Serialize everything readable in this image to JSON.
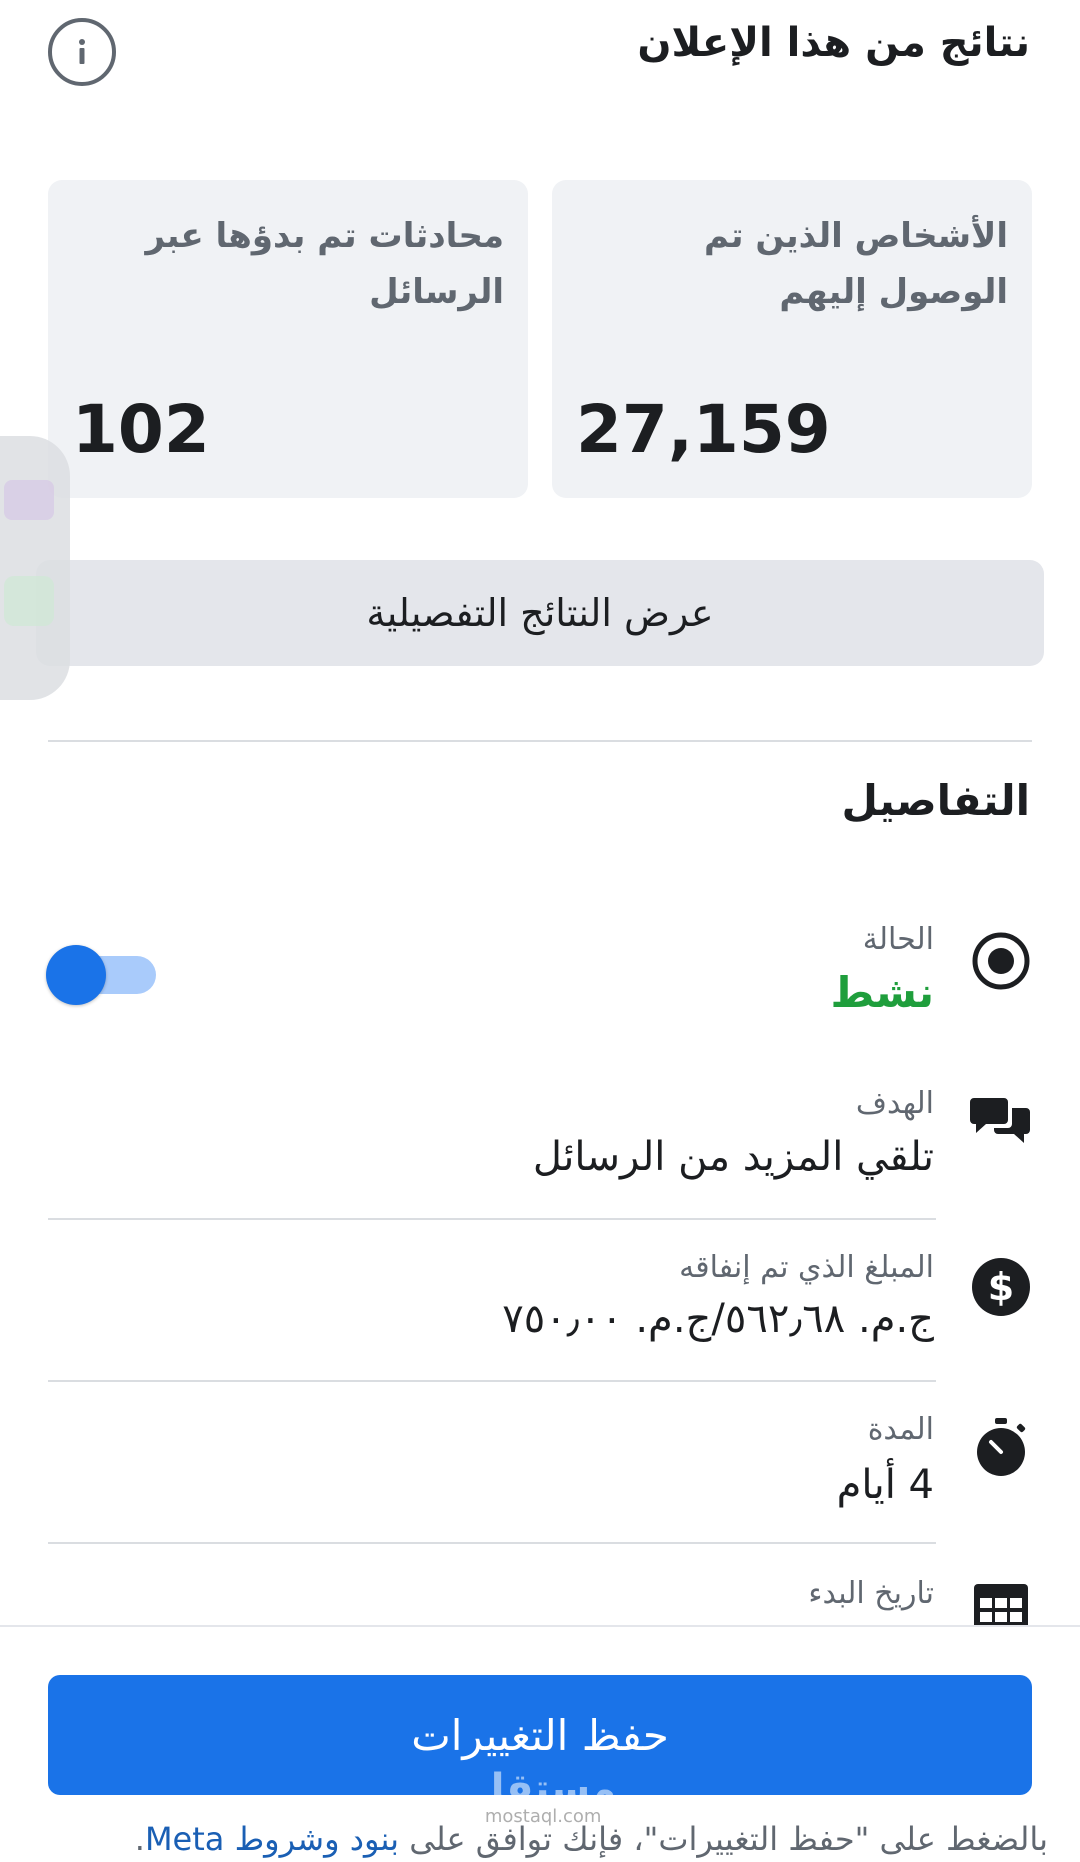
{
  "header": {
    "title": "نتائج من هذا الإعلان",
    "info_icon": "info-icon"
  },
  "stats": [
    {
      "label": "الأشخاص الذين تم الوصول إليهم",
      "value": "27,159"
    },
    {
      "label": "محادثات تم بدؤها عبر الرسائل",
      "value": "102"
    }
  ],
  "detailed_results_button": "عرض النتائج التفصيلية",
  "details": {
    "title": "التفاصيل",
    "status": {
      "label": "الحالة",
      "value": "نشط",
      "icon": "radio-target-icon",
      "toggle_on": true,
      "value_color": "#1f9e3c"
    },
    "goal": {
      "label": "الهدف",
      "value": "تلقي المزيد من الرسائل",
      "icon": "messages-icon"
    },
    "spent": {
      "label": "المبلغ الذي تم إنفاقه",
      "value": "ج.م. ٥٦٢٫٦٨/ج.م. ٧٥٠٫٠٠",
      "icon": "dollar-icon"
    },
    "duration": {
      "label": "المدة",
      "value": "4 أيام",
      "icon": "stopwatch-icon"
    },
    "start_date": {
      "label": "تاريخ البدء",
      "icon": "calendar-icon"
    }
  },
  "save_button": "حفظ التغييرات",
  "terms": {
    "text": "بالضغط على \"حفظ التغييرات\"، فإنك توافق على ",
    "link": "بنود وشروط Meta",
    "end": "."
  },
  "watermark": {
    "text": "مستقل",
    "sub": "mostaql.com"
  },
  "colors": {
    "primary": "#1a73e8",
    "active": "#1f9e3c",
    "card_bg": "#f0f2f5"
  }
}
